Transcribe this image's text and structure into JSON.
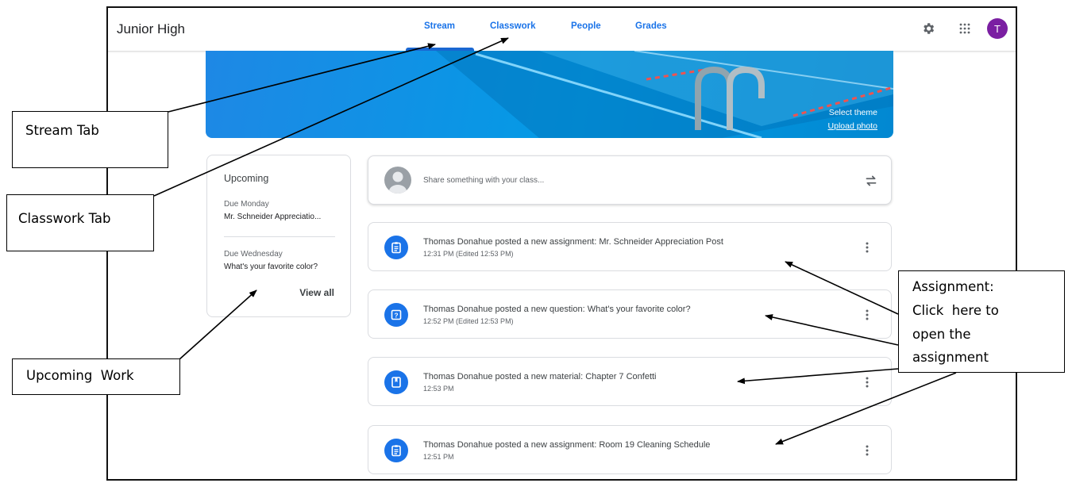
{
  "topbar": {
    "class_name": "Junior High",
    "tabs": [
      {
        "label": "Stream",
        "active": true
      },
      {
        "label": "Classwork"
      },
      {
        "label": "People"
      },
      {
        "label": "Grades"
      }
    ],
    "icons": {
      "settings": "gear-icon",
      "apps": "apps-grid-icon"
    },
    "avatar_letter": "T",
    "accent_color": "#1a73e8",
    "avatar_color": "#7b1fa2"
  },
  "banner": {
    "select_theme": "Select theme",
    "upload_photo": "Upload photo"
  },
  "upcoming": {
    "title": "Upcoming",
    "items": [
      {
        "due": "Due Monday",
        "title": "Mr. Schneider Appreciatio..."
      },
      {
        "due": "Due Wednesday",
        "title": "What's your favorite color?"
      }
    ],
    "view_all": "View all"
  },
  "share": {
    "placeholder": "Share something with your class..."
  },
  "posts": [
    {
      "title": "Thomas Donahue posted a new assignment: Mr. Schneider Appreciation Post",
      "time": "12:31 PM (Edited 12:53 PM)",
      "icon": "assignment-icon"
    },
    {
      "title": "Thomas Donahue posted a new question: What's your favorite color?",
      "time": "12:52 PM (Edited 12:53 PM)",
      "icon": "question-icon"
    },
    {
      "title": "Thomas Donahue posted a new material: Chapter 7 Confetti",
      "time": "12:53 PM",
      "icon": "material-icon"
    },
    {
      "title": "Thomas Donahue posted a new assignment: Room 19 Cleaning Schedule",
      "time": "12:51 PM",
      "icon": "assignment-icon"
    }
  ],
  "annotations": {
    "stream_tab": "Stream Tab",
    "classwork_tab": "Classwork Tab",
    "upcoming_work": "Upcoming  Work",
    "assignment_lines": [
      "Assignment:",
      "Click  here to",
      "open the",
      "assignment"
    ]
  }
}
